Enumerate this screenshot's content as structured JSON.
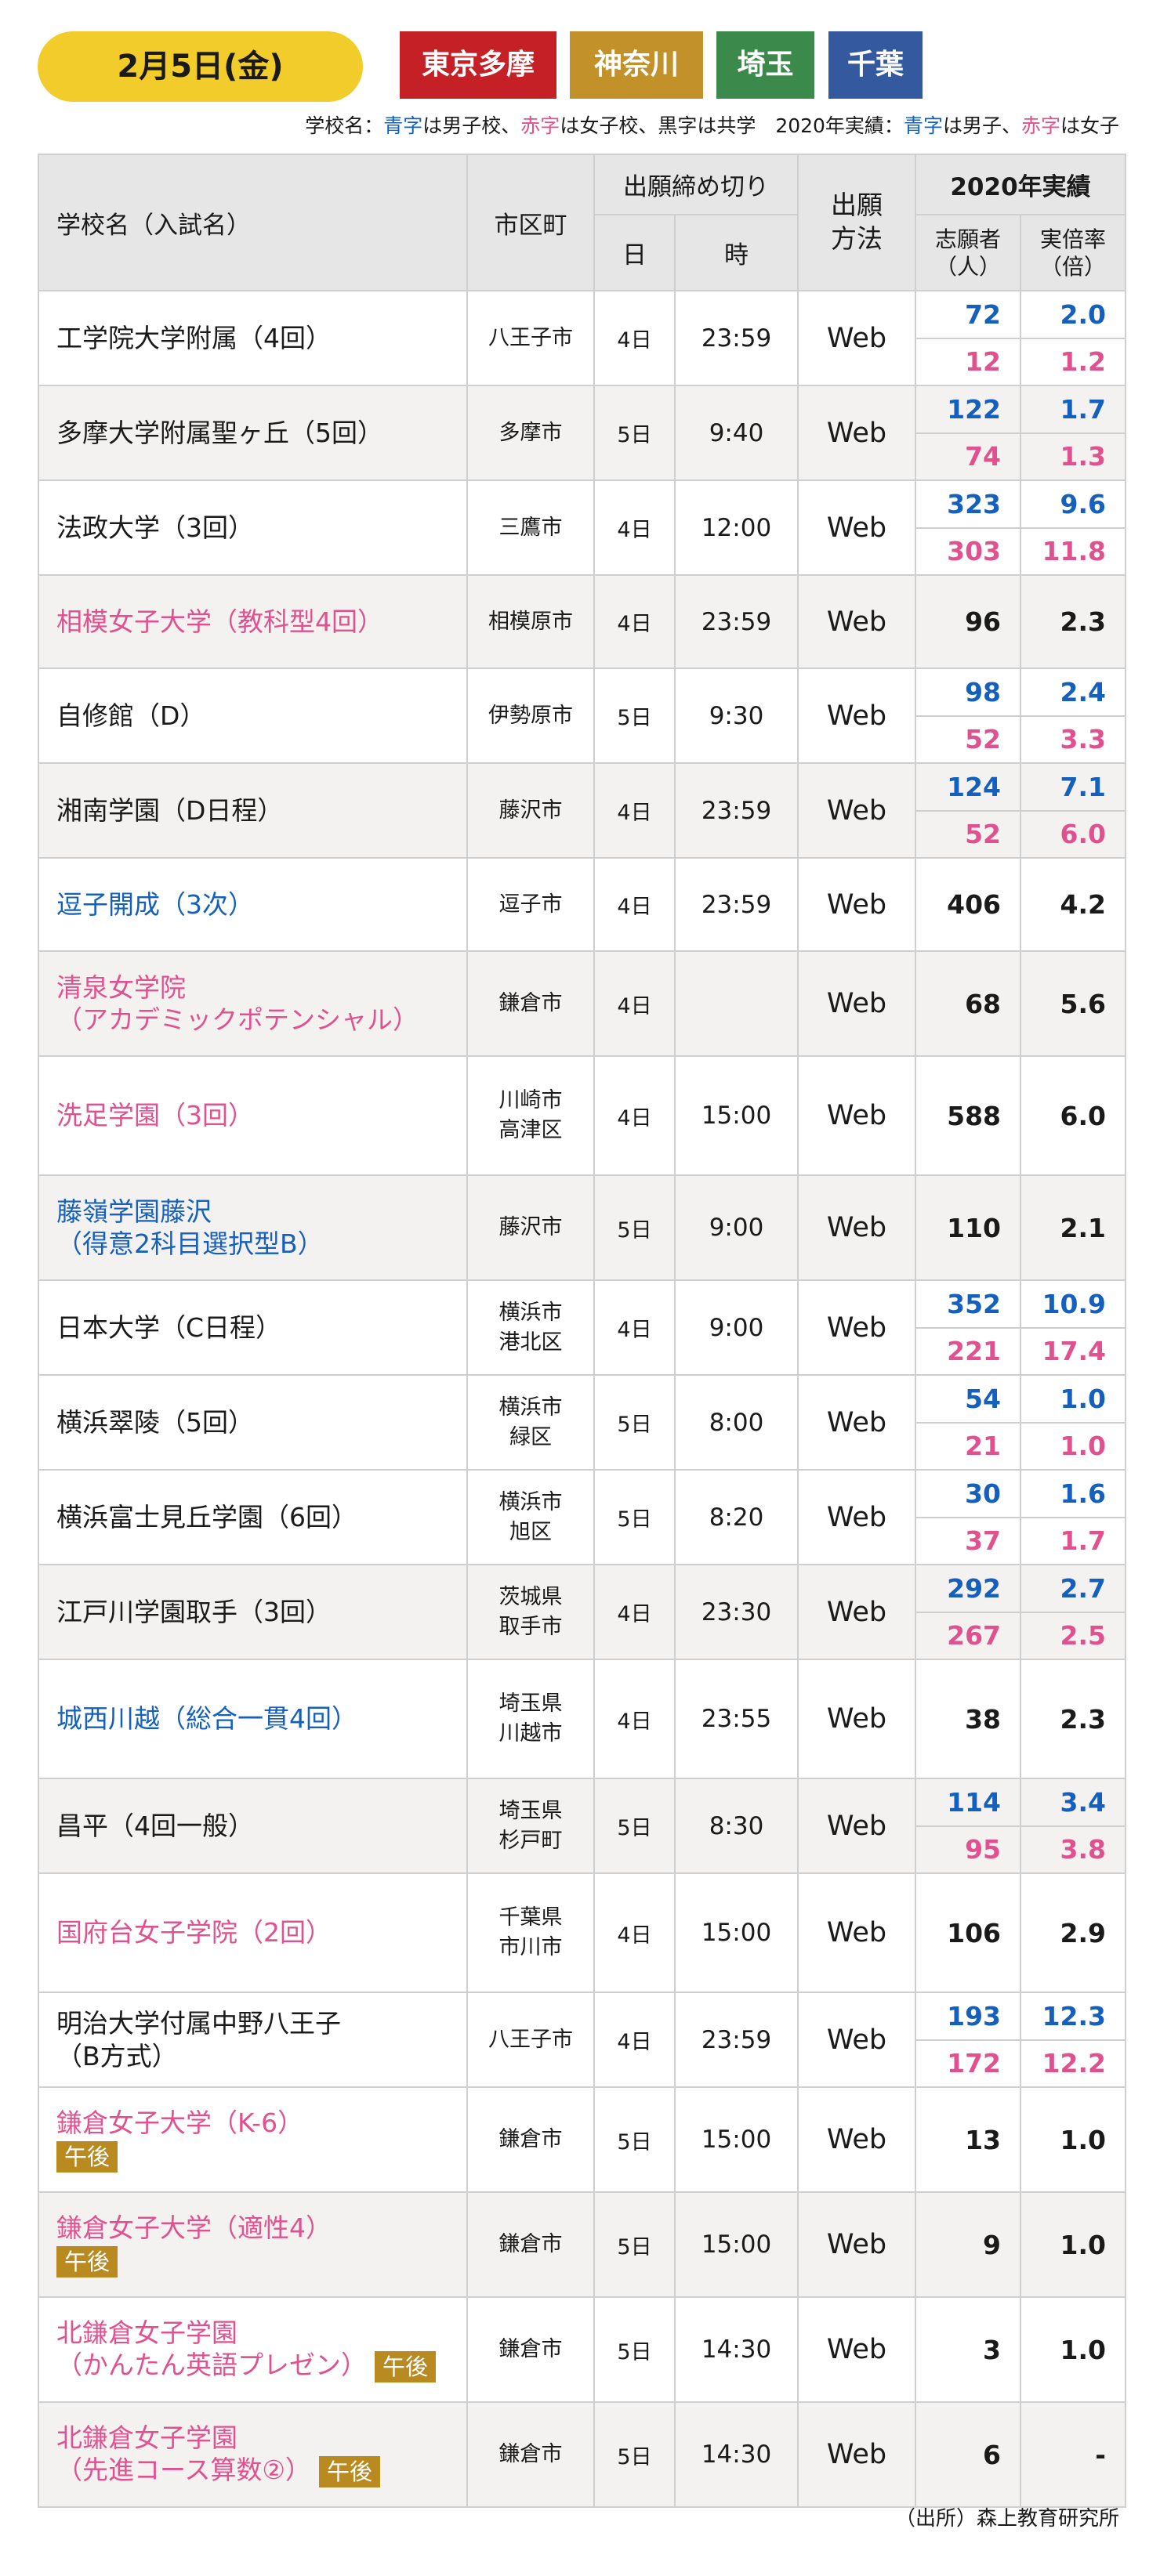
{
  "header": {
    "date": "2月5日(金)",
    "prefectures": [
      {
        "label": "東京多摩",
        "color": "#c62027"
      },
      {
        "label": "神奈川",
        "color": "#c2912a"
      },
      {
        "label": "埼玉",
        "color": "#3b8a4c"
      },
      {
        "label": "千葉",
        "color": "#34599f"
      }
    ],
    "legend": {
      "p1": "学校名：",
      "blue": "青字",
      "p2": "は男子校、",
      "red": "赤字",
      "p3": "は女子校、黒字は共学　2020年実績：",
      "blue2": "青字",
      "p4": "は男子、",
      "red2": "赤字",
      "p5": "は女子"
    }
  },
  "table": {
    "headers": {
      "school": "学校名（入試名）",
      "city": "市区町",
      "deadline": "出願締め切り",
      "day": "日",
      "time": "時",
      "method": "出願\n方法",
      "results": "2020年実績",
      "applicants": "志願者\n（人）",
      "ratio": "実倍率\n（倍）"
    },
    "rows": [
      {
        "name": "工学院大学附属（4回）",
        "color": "black",
        "city": "八王子市",
        "day": "4日",
        "time": "23:59",
        "method": "Web",
        "split": true,
        "app_m": "72",
        "app_f": "12",
        "rat_m": "2.0",
        "rat_f": "1.2"
      },
      {
        "name": "多摩大学附属聖ヶ丘（5回）",
        "color": "black",
        "city": "多摩市",
        "day": "5日",
        "time": "9:40",
        "method": "Web",
        "split": true,
        "app_m": "122",
        "app_f": "74",
        "rat_m": "1.7",
        "rat_f": "1.3"
      },
      {
        "name": "法政大学（3回）",
        "color": "black",
        "city": "三鷹市",
        "day": "4日",
        "time": "12:00",
        "method": "Web",
        "split": true,
        "app_m": "323",
        "app_f": "303",
        "rat_m": "9.6",
        "rat_f": "11.8"
      },
      {
        "name": "相模女子大学（教科型4回）",
        "color": "red",
        "city": "相模原市",
        "day": "4日",
        "time": "23:59",
        "method": "Web",
        "split": false,
        "app": "96",
        "rat": "2.3"
      },
      {
        "name": "自修館（D）",
        "color": "black",
        "city": "伊勢原市",
        "day": "5日",
        "time": "9:30",
        "method": "Web",
        "split": true,
        "app_m": "98",
        "app_f": "52",
        "rat_m": "2.4",
        "rat_f": "3.3"
      },
      {
        "name": "湘南学園（D日程）",
        "color": "black",
        "city": "藤沢市",
        "day": "4日",
        "time": "23:59",
        "method": "Web",
        "split": true,
        "app_m": "124",
        "app_f": "52",
        "rat_m": "7.1",
        "rat_f": "6.0"
      },
      {
        "name": "逗子開成（3次）",
        "color": "blue",
        "city": "逗子市",
        "day": "4日",
        "time": "23:59",
        "method": "Web",
        "split": false,
        "app": "406",
        "rat": "4.2"
      },
      {
        "name": "清泉女学院\n（アカデミックポテンシャル）",
        "color": "red",
        "city": "鎌倉市",
        "day": "4日",
        "time": "",
        "method": "Web",
        "split": false,
        "app": "68",
        "rat": "5.6"
      },
      {
        "name": "洗足学園（3回）",
        "color": "red",
        "city": "川崎市\n高津区",
        "day": "4日",
        "time": "15:00",
        "method": "Web",
        "split": false,
        "app": "588",
        "rat": "6.0"
      },
      {
        "name": "藤嶺学園藤沢\n（得意2科目選択型B）",
        "color": "blue",
        "city": "藤沢市",
        "day": "5日",
        "time": "9:00",
        "method": "Web",
        "split": false,
        "app": "110",
        "rat": "2.1"
      },
      {
        "name": "日本大学（C日程）",
        "color": "black",
        "city": "横浜市\n港北区",
        "day": "4日",
        "time": "9:00",
        "method": "Web",
        "split": true,
        "app_m": "352",
        "app_f": "221",
        "rat_m": "10.9",
        "rat_f": "17.4"
      },
      {
        "name": "横浜翠陵（5回）",
        "color": "black",
        "city": "横浜市\n緑区",
        "day": "5日",
        "time": "8:00",
        "method": "Web",
        "split": true,
        "app_m": "54",
        "app_f": "21",
        "rat_m": "1.0",
        "rat_f": "1.0"
      },
      {
        "name": "横浜富士見丘学園（6回）",
        "color": "black",
        "city": "横浜市\n旭区",
        "day": "5日",
        "time": "8:20",
        "method": "Web",
        "split": true,
        "app_m": "30",
        "app_f": "37",
        "rat_m": "1.6",
        "rat_f": "1.7"
      },
      {
        "name": "江戸川学園取手（3回）",
        "color": "black",
        "city": "茨城県\n取手市",
        "day": "4日",
        "time": "23:30",
        "method": "Web",
        "split": true,
        "app_m": "292",
        "app_f": "267",
        "rat_m": "2.7",
        "rat_f": "2.5"
      },
      {
        "name": "城西川越（総合一貫4回）",
        "color": "blue",
        "city": "埼玉県\n川越市",
        "day": "4日",
        "time": "23:55",
        "method": "Web",
        "split": false,
        "app": "38",
        "rat": "2.3"
      },
      {
        "name": "昌平（4回一般）",
        "color": "black",
        "city": "埼玉県\n杉戸町",
        "day": "5日",
        "time": "8:30",
        "method": "Web",
        "split": true,
        "app_m": "114",
        "app_f": "95",
        "rat_m": "3.4",
        "rat_f": "3.8"
      },
      {
        "name": "国府台女子学院（2回）",
        "color": "red",
        "city": "千葉県\n市川市",
        "day": "4日",
        "time": "15:00",
        "method": "Web",
        "split": false,
        "app": "106",
        "rat": "2.9"
      },
      {
        "name": "明治大学付属中野八王子\n（B方式）",
        "color": "black",
        "city": "八王子市",
        "day": "4日",
        "time": "23:59",
        "method": "Web",
        "split": true,
        "app_m": "193",
        "app_f": "172",
        "rat_m": "12.3",
        "rat_f": "12.2"
      },
      {
        "name": "鎌倉女子大学（K-6）",
        "color": "red",
        "badge": "午後",
        "badge_newline": true,
        "city": "鎌倉市",
        "day": "5日",
        "time": "15:00",
        "method": "Web",
        "split": false,
        "app": "13",
        "rat": "1.0"
      },
      {
        "name": "鎌倉女子大学（適性4）",
        "color": "red",
        "badge": "午後",
        "badge_newline": true,
        "city": "鎌倉市",
        "day": "5日",
        "time": "15:00",
        "method": "Web",
        "split": false,
        "app": "9",
        "rat": "1.0"
      },
      {
        "name": "北鎌倉女子学園\n（かんたん英語プレゼン）",
        "color": "red",
        "badge": "午後",
        "badge_newline": false,
        "city": "鎌倉市",
        "day": "5日",
        "time": "14:30",
        "method": "Web",
        "split": false,
        "app": "3",
        "rat": "1.0"
      },
      {
        "name": "北鎌倉女子学園\n（先進コース算数②）",
        "color": "red",
        "badge": "午後",
        "badge_newline": false,
        "city": "鎌倉市",
        "day": "5日",
        "time": "14:30",
        "method": "Web",
        "split": false,
        "app": "6",
        "rat": "-"
      }
    ]
  },
  "source": "（出所）森上教育研究所"
}
